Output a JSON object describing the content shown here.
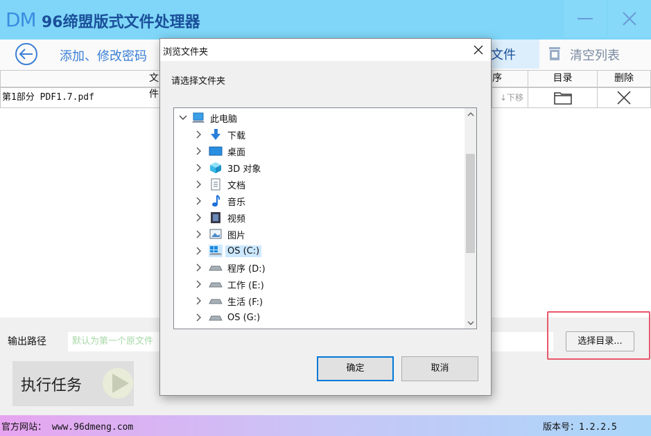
{
  "app": {
    "logo": "DM",
    "title": "96缔盟版式文件处理器"
  },
  "toolbar": {
    "add_label": "添加、修改密码",
    "file_label": "文件",
    "clear_label": "清空列表"
  },
  "table": {
    "headers": {
      "file": "文件",
      "order": "序",
      "dir": "目录",
      "delete": "删除"
    },
    "rows": [
      {
        "name": "第1部分 PDF1.7.pdf",
        "move_down": "↓下移"
      }
    ]
  },
  "output": {
    "label": "输出路径",
    "placeholder": "默认为第一个原文件",
    "choose_dir": "选择目录..."
  },
  "execute": {
    "label": "执行任务"
  },
  "footer": {
    "site": "官方网站： www.96dmeng.com",
    "version": "版本号：1.2.2.5"
  },
  "dialog": {
    "title": "浏览文件夹",
    "prompt": "请选择文件夹",
    "ok": "确定",
    "cancel": "取消",
    "tree": {
      "root": "此电脑",
      "items": [
        {
          "label": "下载",
          "icon": "download-arrow-icon"
        },
        {
          "label": "桌面",
          "icon": "desktop-icon"
        },
        {
          "label": "3D 对象",
          "icon": "3d-objects-icon"
        },
        {
          "label": "文档",
          "icon": "document-icon"
        },
        {
          "label": "音乐",
          "icon": "music-note-icon"
        },
        {
          "label": "视频",
          "icon": "video-film-icon"
        },
        {
          "label": "图片",
          "icon": "picture-icon"
        },
        {
          "label": "OS (C:)",
          "icon": "windows-drive-icon",
          "selected": true
        },
        {
          "label": "程序 (D:)",
          "icon": "drive-icon"
        },
        {
          "label": "工作 (E:)",
          "icon": "drive-icon"
        },
        {
          "label": "生活 (F:)",
          "icon": "drive-icon"
        },
        {
          "label": "OS (G:)",
          "icon": "drive-icon"
        }
      ]
    }
  },
  "colors": {
    "titlebar": "#7fd6f8",
    "accent": "#3a7fd5",
    "highlight": "#e8566a",
    "selection": "#cce8ff"
  }
}
